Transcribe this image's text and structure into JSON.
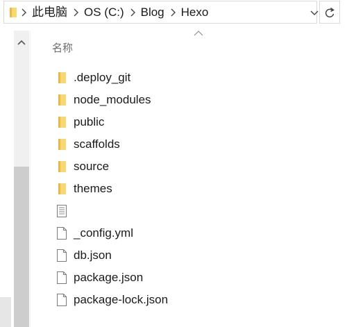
{
  "breadcrumbs": [
    "此电脑",
    "OS (C:)",
    "Blog",
    "Hexo"
  ],
  "column_header": "名称",
  "items": [
    {
      "name": ".deploy_git",
      "type": "folder",
      "icon": "folder-icon"
    },
    {
      "name": "node_modules",
      "type": "folder",
      "icon": "folder-icon"
    },
    {
      "name": "public",
      "type": "folder",
      "icon": "folder-icon"
    },
    {
      "name": "scaffolds",
      "type": "folder",
      "icon": "folder-icon"
    },
    {
      "name": "source",
      "type": "folder",
      "icon": "folder-icon"
    },
    {
      "name": "themes",
      "type": "folder",
      "icon": "folder-icon"
    },
    {
      "name": "",
      "type": "text-file",
      "icon": "text-file-icon"
    },
    {
      "name": "_config.yml",
      "type": "file",
      "icon": "file-icon"
    },
    {
      "name": "db.json",
      "type": "file",
      "icon": "file-icon"
    },
    {
      "name": "package.json",
      "type": "file",
      "icon": "file-icon"
    },
    {
      "name": "package-lock.json",
      "type": "file",
      "icon": "file-icon"
    }
  ],
  "colors": {
    "folder": "#f8d775",
    "folder_dark": "#e9b949",
    "border": "#d9d9d9"
  }
}
